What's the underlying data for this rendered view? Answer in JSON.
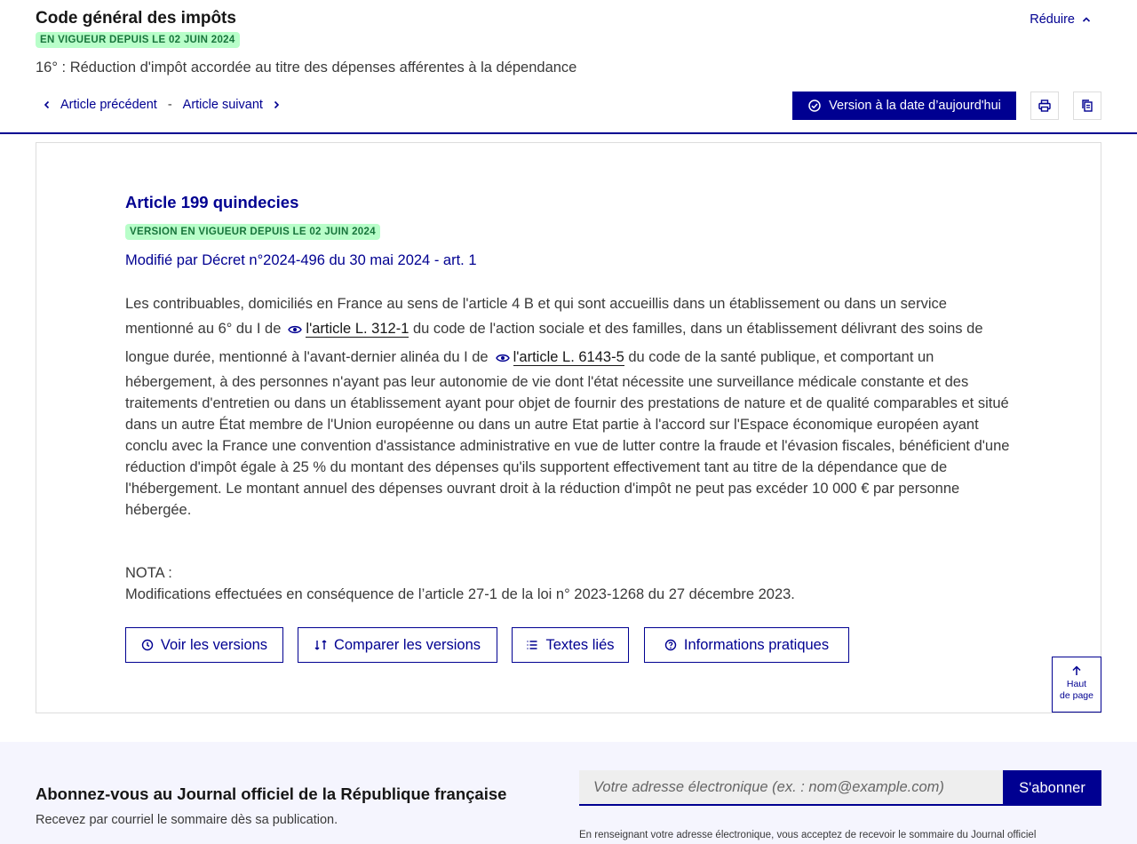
{
  "header": {
    "code_title": "Code général des impôts",
    "status_badge": "En vigueur depuis le 02 juin 2024",
    "section_title": "16° : Réduction d'impôt accordée au titre des dépenses afférentes à la dépendance",
    "reduce_label": "Réduire",
    "prev_label": "Article précédent",
    "separator": "-",
    "next_label": "Article suivant",
    "version_today_label": "Version à la date d’aujourd'hui",
    "icons": {
      "print": "print-icon",
      "copy": "copy-icon",
      "check": "check-circle-icon"
    }
  },
  "article": {
    "title": "Article 199 quindecies",
    "badge": "Version en vigueur depuis le 02 juin 2024",
    "modified_by": "Modifié par Décret n°2024-496 du 30 mai 2024 - art. 1",
    "body": {
      "part1": "Les contribuables, domiciliés en France au sens de l'article 4 B et qui sont accueillis dans un établissement ou dans un service mentionné au 6° du I de",
      "link1": "l'article L. 312-1",
      "part2": "du code de l'action sociale et des familles, dans un établissement délivrant des soins de longue durée, mentionné à l'avant-dernier alinéa du I de",
      "link2": "l'article L. 6143-5",
      "part3": "du code de la santé publique, et comportant un hébergement, à des personnes n'ayant pas leur autonomie de vie dont l'état nécessite une surveillance médicale constante et des traitements d'entretien ou dans un établissement ayant pour objet de fournir des prestations de nature et de qualité comparables et situé dans un autre État membre de l'Union européenne ou dans un autre Etat partie à l'accord sur l'Espace économique européen ayant conclu avec la France une convention d'assistance administrative en vue de lutter contre la fraude et l'évasion fiscales, bénéficient d'une réduction d'impôt égale à 25 % du montant des dépenses qu'ils supportent effectivement tant au titre de la dépendance que de l'hébergement. Le montant annuel des dépenses ouvrant droit à la réduction d'impôt ne peut pas excéder 10 000 € par personne hébergée."
    },
    "nota_label": "NOTA :",
    "nota_text": "Modifications effectuées en conséquence de l’article 27-1 de la loi n° 2023-1268 du 27 décembre 2023.",
    "actions": {
      "versions": "Voir les versions",
      "compare": "Comparer les versions",
      "textes": "Textes liés",
      "infos": "Informations pratiques"
    },
    "back_top_line1": "Haut",
    "back_top_line2": "de page"
  },
  "newsletter": {
    "title": "Abonnez-vous au Journal officiel de la République française",
    "subtitle": "Recevez par courriel le sommaire dès sa publication.",
    "input_placeholder": "Votre adresse électronique (ex. : nom@example.com)",
    "subscribe_label": "S'abonner",
    "note": "En renseignant votre adresse électronique, vous acceptez de recevoir le sommaire du Journal officiel"
  },
  "colors": {
    "primary": "#000091",
    "badge_bg": "#b8fec9",
    "badge_text": "#18753c",
    "footer_bg": "#f5f5fe"
  }
}
